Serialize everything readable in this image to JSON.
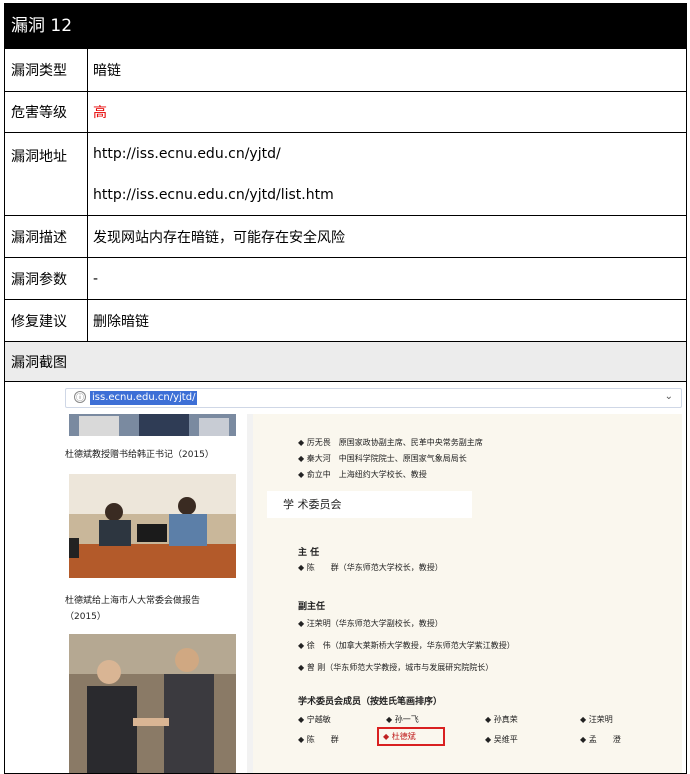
{
  "header": {
    "title": "漏洞 12"
  },
  "fields": {
    "type": {
      "label": "漏洞类型",
      "value": "暗链"
    },
    "level": {
      "label": "危害等级",
      "value": "高"
    },
    "addr": {
      "label": "漏洞地址",
      "lines": [
        "http://iss.ecnu.edu.cn/yjtd/",
        "http://iss.ecnu.edu.cn/yjtd/list.htm"
      ]
    },
    "desc": {
      "label": "漏洞描述",
      "value": "发现网站内存在暗链，可能存在安全风险"
    },
    "param": {
      "label": "漏洞参数",
      "value": "-"
    },
    "fix": {
      "label": "修复建议",
      "value": "删除暗链"
    },
    "screenshot": {
      "label": "漏洞截图"
    }
  },
  "browser": {
    "url": "iss.ecnu.edu.cn/yjtd/",
    "info_glyph": "ⓘ",
    "chevron_glyph": "⌄"
  },
  "page": {
    "captions": [
      "杜德斌教授赠书给韩正书记（2015）",
      "杜德斌给上海市人大常委会做报告",
      "（2015）"
    ],
    "top_list": [
      "◆ 厉无畏　原国家政协副主席、民革中央常务副主席",
      "◆ 秦大河　中国科学院院士、原国家气象局局长",
      "◆ 俞立中　上海纽约大学校长、教授"
    ],
    "section": "学 术委员会",
    "director_label": "主 任",
    "director": "◆ 陈　　群（华东师范大学校长，教授）",
    "deputy_label": "副主任",
    "deputies": [
      "◆ 汪荣明（华东师范大学副校长，教授）",
      "◆ 徐　伟（加拿大莱斯桥大学教授，华东师范大学紫江教授）",
      "◆ 曾 刚（华东师范大学教授，城市与发展研究院院长）"
    ],
    "members_label": "学术委员会成员（按姓氏笔画排序）",
    "members_row1": [
      "◆ 宁越敏",
      "◆ 孙一飞",
      "◆ 孙真荣",
      "◆ 汪荣明"
    ],
    "members_row2": [
      "◆ 陈　　群",
      "◆ 吴维平",
      "◆ 孟　　澄"
    ],
    "highlighted_member": "◆ 杜德斌"
  },
  "colors": {
    "title_bg": "#000000",
    "danger": "#e60000",
    "highlight_box": "#d92020",
    "url_selection": "#3d6fd6"
  }
}
